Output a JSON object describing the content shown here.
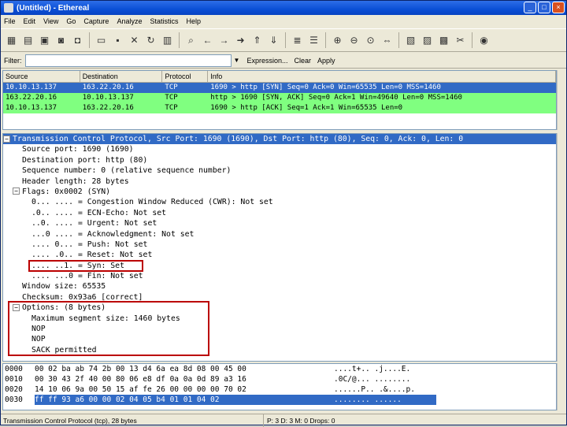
{
  "window": {
    "title": "(Untitled) - Ethereal",
    "minimize": "_",
    "maximize": "□",
    "close": "×"
  },
  "menu": [
    "File",
    "Edit",
    "View",
    "Go",
    "Capture",
    "Analyze",
    "Statistics",
    "Help"
  ],
  "filter": {
    "label": "Filter:",
    "value": "",
    "expression": "Expression...",
    "clear": "Clear",
    "apply": "Apply"
  },
  "packet_list": {
    "columns": [
      "Source",
      "Destination",
      "Protocol",
      "Info"
    ],
    "rows": [
      {
        "source": "10.10.13.137",
        "destination": "163.22.20.16",
        "protocol": "TCP",
        "info": "1690 > http [SYN] Seq=0 Ack=0 Win=65535 Len=0 MSS=1460"
      },
      {
        "source": "163.22.20.16",
        "destination": "10.10.13.137",
        "protocol": "TCP",
        "info": "http > 1690 [SYN, ACK] Seq=0 Ack=1 Win=49640 Len=0 MSS=1460"
      },
      {
        "source": "10.10.13.137",
        "destination": "163.22.20.16",
        "protocol": "TCP",
        "info": "1690 > http [ACK] Seq=1 Ack=1 Win=65535 Len=0"
      }
    ]
  },
  "details": {
    "header": "Transmission Control Protocol, Src Port: 1690 (1690), Dst Port: http (80), Seq: 0, Ack: 0, Len: 0",
    "lines": [
      "Source port: 1690 (1690)",
      "Destination port: http (80)",
      "Sequence number: 0    (relative sequence number)",
      "Header length: 28 bytes"
    ],
    "flags_header": "Flags: 0x0002 (SYN)",
    "flags": [
      "0... .... = Congestion Window Reduced (CWR): Not set",
      ".0.. .... = ECN-Echo: Not set",
      "..0. .... = Urgent: Not set",
      "...0 .... = Acknowledgment: Not set",
      ".... 0... = Push: Not set",
      ".... .0.. = Reset: Not set",
      ".... ..1. = Syn: Set",
      ".... ...0 = Fin: Not set"
    ],
    "window": "Window size: 65535",
    "checksum": "Checksum: 0x93a6 [correct]",
    "options_header": "Options: (8 bytes)",
    "options": [
      "Maximum segment size: 1460 bytes",
      "NOP",
      "NOP",
      "SACK permitted"
    ]
  },
  "hex": [
    {
      "offset": "0000",
      "bytes": "00 02 ba ab 74 2b 00 13  d4 6a ea 8d 08 00 45 00",
      "ascii": "....t+.. .j....E."
    },
    {
      "offset": "0010",
      "bytes": "00 30 43 2f 40 00 80 06  e8 df 0a 0a 0d 89 a3 16",
      "ascii": ".0C/@... ........"
    },
    {
      "offset": "0020",
      "bytes": "14 10 06 9a 00 50 15 af  fe 26 00 00 00 00 70 02",
      "ascii": "......P.. .&....p."
    },
    {
      "offset": "0030",
      "bytes": "ff ff 93 a6 00 00 02 04  05 b4 01 01 04 02",
      "ascii": "........ ......"
    }
  ],
  "status": {
    "left": "Transmission Control Protocol (tcp), 28 bytes",
    "right": "P: 3 D: 3 M: 0 Drops: 0"
  }
}
